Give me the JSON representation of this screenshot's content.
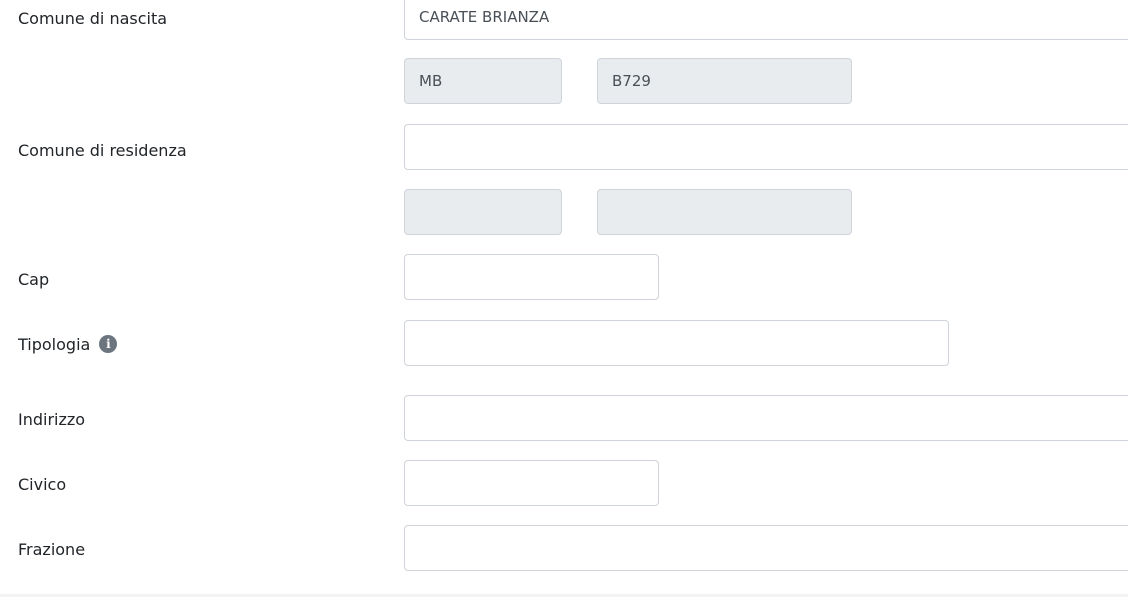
{
  "form": {
    "comune_nascita": {
      "label": "Comune di nascita",
      "value": "CARATE BRIANZA",
      "provincia": "MB",
      "codice": "B729"
    },
    "comune_residenza": {
      "label": "Comune di residenza",
      "value": "",
      "provincia": "",
      "codice": ""
    },
    "cap": {
      "label": "Cap",
      "value": ""
    },
    "tipologia": {
      "label": "Tipologia",
      "value": "",
      "icon": "info-icon",
      "icon_glyph": "i"
    },
    "indirizzo": {
      "label": "Indirizzo",
      "value": ""
    },
    "civico": {
      "label": "Civico",
      "value": ""
    },
    "frazione": {
      "label": "Frazione",
      "value": ""
    }
  },
  "colors": {
    "border": "#ced4da",
    "readonly_bg": "#e9ecef",
    "text": "#212529",
    "info_icon": "#6c757d"
  }
}
